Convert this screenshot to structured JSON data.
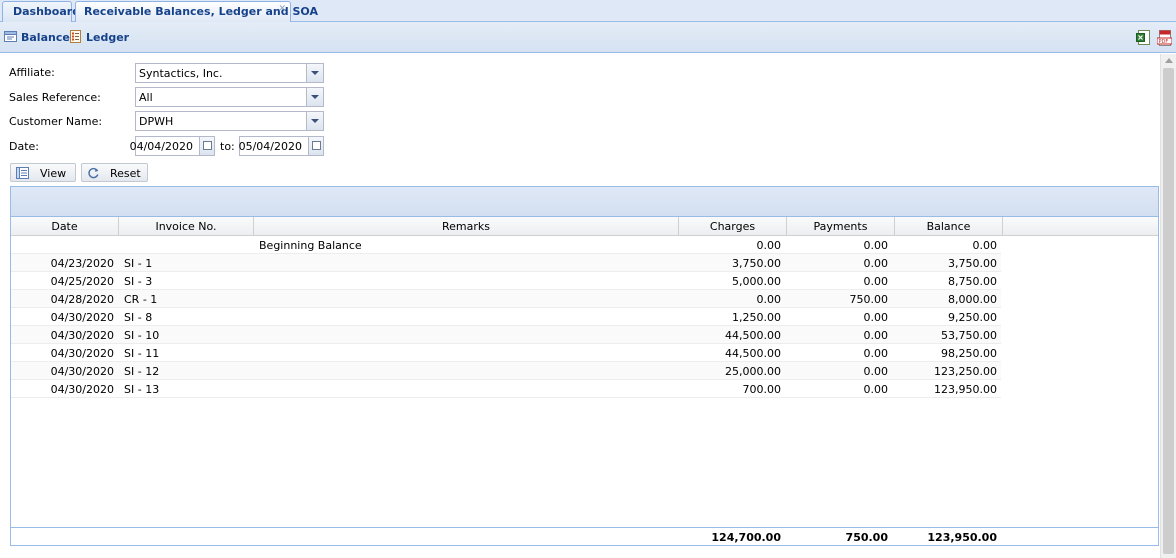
{
  "tabs": [
    {
      "label": "Dashboard"
    },
    {
      "label": "Receivable Balances, Ledger and SOA"
    }
  ],
  "toolbar": {
    "balance_label": "Balance",
    "ledger_label": "Ledger",
    "excel_icon": "excel-export-icon",
    "pdf_icon": "pdf-export-icon"
  },
  "form": {
    "affiliate_label": "Affiliate:",
    "affiliate_value": "Syntactics, Inc.",
    "sales_ref_label": "Sales Reference:",
    "sales_ref_value": "All",
    "customer_label": "Customer Name:",
    "customer_value": "DPWH",
    "date_label": "Date:",
    "date_from": "04/04/2020",
    "to_label": "to:",
    "date_to": "05/04/2020",
    "view_label": "View",
    "reset_label": "Reset"
  },
  "grid": {
    "columns": [
      "Date",
      "Invoice No.",
      "Remarks",
      "Charges",
      "Payments",
      "Balance"
    ],
    "rows": [
      {
        "date": "",
        "invoice": "",
        "remarks": "Beginning Balance",
        "charges": "0.00",
        "payments": "0.00",
        "balance": "0.00"
      },
      {
        "date": "04/23/2020",
        "invoice": "SI - 1",
        "remarks": "",
        "charges": "3,750.00",
        "payments": "0.00",
        "balance": "3,750.00"
      },
      {
        "date": "04/25/2020",
        "invoice": "SI - 3",
        "remarks": "",
        "charges": "5,000.00",
        "payments": "0.00",
        "balance": "8,750.00"
      },
      {
        "date": "04/28/2020",
        "invoice": "CR - 1",
        "remarks": "",
        "charges": "0.00",
        "payments": "750.00",
        "balance": "8,000.00"
      },
      {
        "date": "04/30/2020",
        "invoice": "SI - 8",
        "remarks": "",
        "charges": "1,250.00",
        "payments": "0.00",
        "balance": "9,250.00"
      },
      {
        "date": "04/30/2020",
        "invoice": "SI - 10",
        "remarks": "",
        "charges": "44,500.00",
        "payments": "0.00",
        "balance": "53,750.00"
      },
      {
        "date": "04/30/2020",
        "invoice": "SI - 11",
        "remarks": "",
        "charges": "44,500.00",
        "payments": "0.00",
        "balance": "98,250.00"
      },
      {
        "date": "04/30/2020",
        "invoice": "SI - 12",
        "remarks": "",
        "charges": "25,000.00",
        "payments": "0.00",
        "balance": "123,250.00"
      },
      {
        "date": "04/30/2020",
        "invoice": "SI - 13",
        "remarks": "",
        "charges": "700.00",
        "payments": "0.00",
        "balance": "123,950.00"
      }
    ],
    "totals": {
      "charges": "124,700.00",
      "payments": "750.00",
      "balance": "123,950.00"
    }
  }
}
